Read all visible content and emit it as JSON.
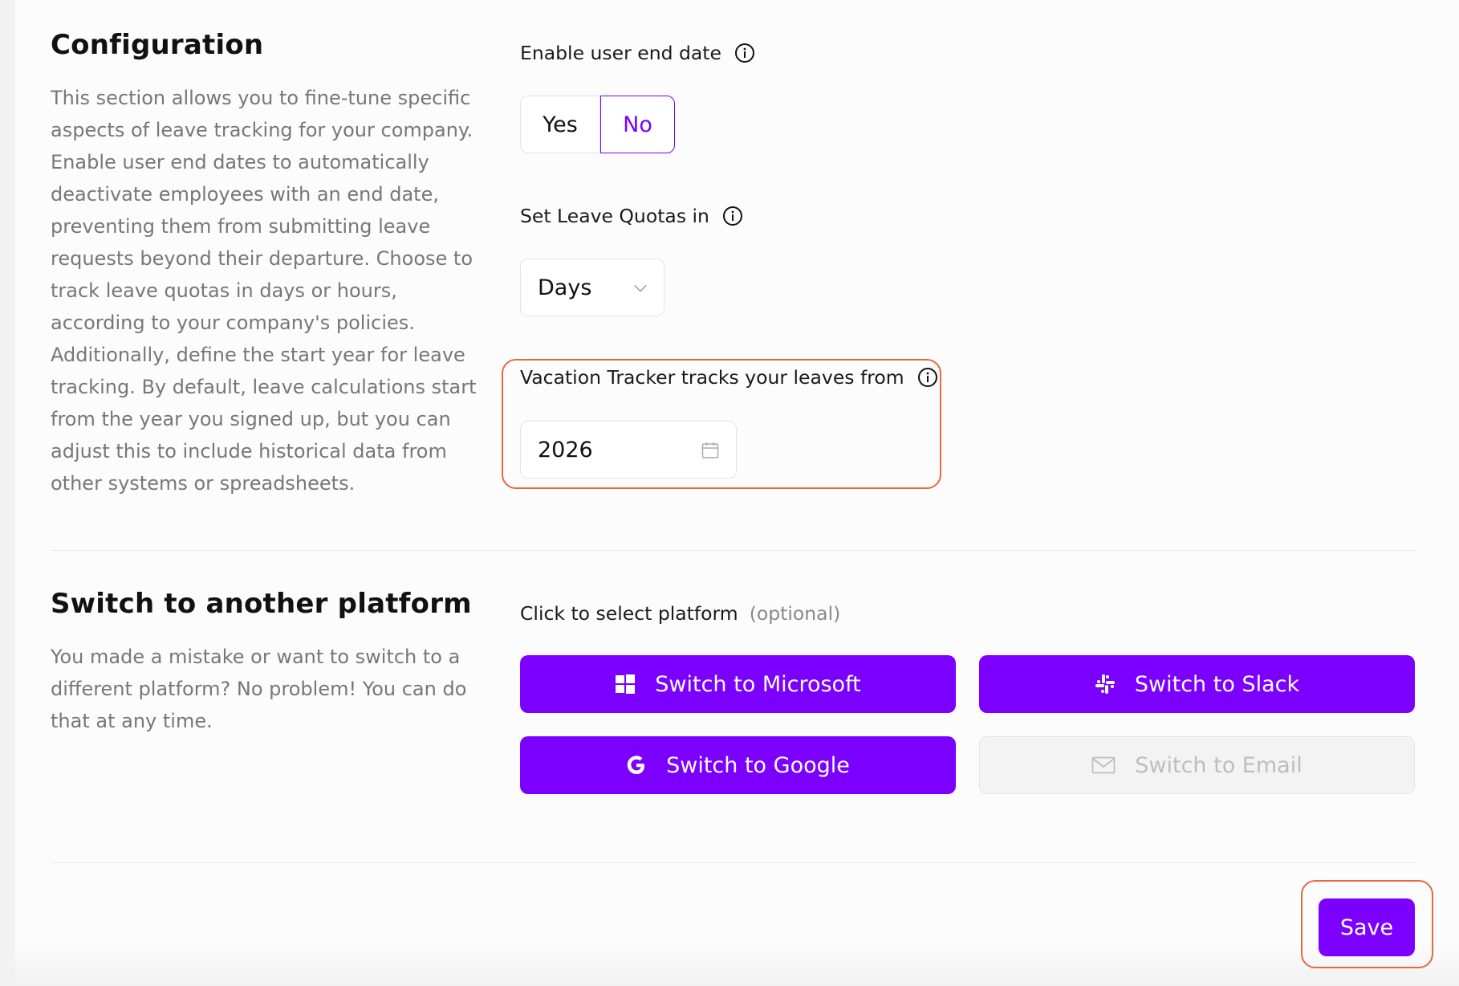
{
  "configuration": {
    "title": "Configuration",
    "description_lines": [
      "This section allows you to fine-tune specific",
      "aspects of leave tracking for your company.",
      "Enable user end dates to automatically",
      "deactivate employees with an end date,",
      "preventing them from submitting leave",
      "requests beyond their departure. Choose to",
      "track leave quotas in days or hours,",
      "according to your company's policies.",
      "Additionally, define the start year for leave",
      "tracking. By default, leave calculations start",
      "from the year you signed up, but you can",
      "adjust this to include historical data from",
      "other systems or spreadsheets."
    ],
    "end_date": {
      "label": "Enable user end date",
      "info_icon": "info-circle-icon",
      "yes_label": "Yes",
      "no_label": "No",
      "selected": "No"
    },
    "quotas": {
      "label": "Set Leave Quotas in",
      "info_icon": "info-circle-icon",
      "value": "Days",
      "icon": "chevron-down-icon"
    },
    "tracking_start": {
      "label": "Vacation Tracker tracks your leaves from",
      "info_icon": "info-circle-icon",
      "value": "2026",
      "icon": "calendar-icon"
    }
  },
  "platform": {
    "title": "Switch to another platform",
    "description_lines": [
      "You made a mistake or want to switch to a",
      "different platform? No problem! You can do",
      "that at any time."
    ],
    "select_label": "Click to select platform",
    "optional_label": "(optional)",
    "buttons": [
      {
        "label": "Switch to Microsoft",
        "icon": "windows-icon",
        "enabled": true
      },
      {
        "label": "Switch to Slack",
        "icon": "slack-icon",
        "enabled": true
      },
      {
        "label": "Switch to Google",
        "icon": "google-icon",
        "enabled": true
      },
      {
        "label": "Switch to Email",
        "icon": "mail-icon",
        "enabled": false
      }
    ]
  },
  "save_label": "Save",
  "colors": {
    "accent": "#7c00ff",
    "highlight": "#e76a3e",
    "muted_text": "#777777"
  }
}
